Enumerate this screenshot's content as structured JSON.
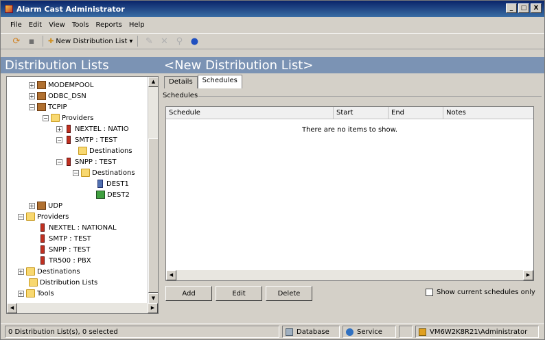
{
  "window": {
    "title": "Alarm Cast Administrator",
    "min": "_",
    "max": "□",
    "close": "X"
  },
  "menu": [
    "File",
    "Edit",
    "View",
    "Tools",
    "Reports",
    "Help"
  ],
  "toolbar": {
    "new_list_label": "New Distribution List"
  },
  "header": {
    "left": "Distribution Lists",
    "right": "<New Distribution List>"
  },
  "tree": [
    {
      "label": "MODEMPOOL",
      "exp": "+",
      "icon": "server"
    },
    {
      "label": "ODBC_DSN",
      "exp": "+",
      "icon": "server"
    },
    {
      "label": "TCPIP",
      "exp": "−",
      "icon": "server"
    },
    {
      "label": "Providers",
      "exp": "−",
      "icon": "folder"
    },
    {
      "label": "NEXTEL : NATIO",
      "exp": "+",
      "icon": "provider"
    },
    {
      "label": "SMTP : TEST",
      "exp": "−",
      "icon": "provider"
    },
    {
      "label": "Destinations",
      "exp": "",
      "icon": "folder"
    },
    {
      "label": "SNPP : TEST",
      "exp": "−",
      "icon": "provider"
    },
    {
      "label": "Destinations",
      "exp": "−",
      "icon": "folder"
    },
    {
      "label": "DEST1",
      "exp": "",
      "icon": "dest1"
    },
    {
      "label": "DEST2",
      "exp": "",
      "icon": "dest2"
    },
    {
      "label": "UDP",
      "exp": "+",
      "icon": "server"
    },
    {
      "label": "Providers",
      "exp": "−",
      "icon": "folder"
    },
    {
      "label": "NEXTEL : NATIONAL",
      "exp": "",
      "icon": "provider"
    },
    {
      "label": "SMTP : TEST",
      "exp": "",
      "icon": "provider"
    },
    {
      "label": "SNPP : TEST",
      "exp": "",
      "icon": "provider"
    },
    {
      "label": "TR500 : PBX",
      "exp": "",
      "icon": "provider"
    },
    {
      "label": "Destinations",
      "exp": "+",
      "icon": "folder"
    },
    {
      "label": "Distribution Lists",
      "exp": "",
      "icon": "folder"
    },
    {
      "label": "Tools",
      "exp": "+",
      "icon": "folder"
    }
  ],
  "tabs": [
    "Details",
    "Schedules"
  ],
  "schedules": {
    "group_label": "Schedules",
    "columns": [
      "Schedule",
      "Start",
      "End",
      "Notes"
    ],
    "empty_text": "There are no items to show."
  },
  "buttons": {
    "add": "Add",
    "edit": "Edit",
    "delete": "Delete"
  },
  "show_current": "Show current schedules only",
  "status": {
    "left": "0 Distribution List(s), 0 selected",
    "database": "Database",
    "service": "Service",
    "user": "VM6W2K8R21\\Administrator"
  }
}
